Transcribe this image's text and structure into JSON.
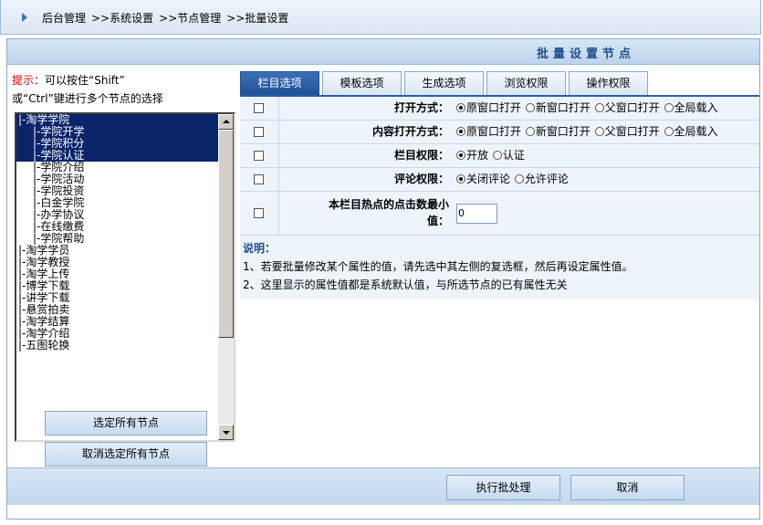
{
  "breadcrumb": [
    "后台管理",
    "系统设置",
    "节点管理",
    "批量设置"
  ],
  "breadcrumb_sep": ">>",
  "panel_title": "批量设置节点",
  "tip": {
    "label": "提示：",
    "line1": "可以按住“Shift”",
    "line2": "或“Ctrl”键进行多个节点的选择"
  },
  "nodes": [
    {
      "label": "|-淘学学院",
      "selected": true,
      "indent": false
    },
    {
      "label": "|-学院开学",
      "selected": true,
      "indent": true
    },
    {
      "label": "|-学院积分",
      "selected": true,
      "indent": true
    },
    {
      "label": "|-学院认证",
      "selected": true,
      "indent": true
    },
    {
      "label": "|-学院介绍",
      "selected": false,
      "indent": true
    },
    {
      "label": "|-学院活动",
      "selected": false,
      "indent": true
    },
    {
      "label": "|-学院投资",
      "selected": false,
      "indent": true
    },
    {
      "label": "|-白金学院",
      "selected": false,
      "indent": true
    },
    {
      "label": "|-办学协议",
      "selected": false,
      "indent": true
    },
    {
      "label": "|-在线缴费",
      "selected": false,
      "indent": true
    },
    {
      "label": "|-学院帮助",
      "selected": false,
      "indent": true
    },
    {
      "label": "|-淘学学员",
      "selected": false,
      "indent": false
    },
    {
      "label": "|-淘学教授",
      "selected": false,
      "indent": false
    },
    {
      "label": "|-淘学上传",
      "selected": false,
      "indent": false
    },
    {
      "label": "|-博学下载",
      "selected": false,
      "indent": false
    },
    {
      "label": "|-讲学下载",
      "selected": false,
      "indent": false
    },
    {
      "label": "|-悬赏拍卖",
      "selected": false,
      "indent": false
    },
    {
      "label": "|-淘学结算",
      "selected": false,
      "indent": false
    },
    {
      "label": "|-淘学介绍",
      "selected": false,
      "indent": false
    },
    {
      "label": "|-五图轮换",
      "selected": false,
      "indent": false
    }
  ],
  "buttons": {
    "select_all": "选定所有节点",
    "deselect_all": "取消选定所有节点",
    "execute": "执行批处理",
    "cancel": "取消"
  },
  "tabs": [
    {
      "label": "栏目选项",
      "active": true
    },
    {
      "label": "模板选项",
      "active": false
    },
    {
      "label": "生成选项",
      "active": false
    },
    {
      "label": "浏览权限",
      "active": false
    },
    {
      "label": "操作权限",
      "active": false
    }
  ],
  "rows": {
    "open_mode": {
      "label": "打开方式：",
      "options": [
        "原窗口打开",
        "新窗口打开",
        "父窗口打开",
        "全局载入"
      ],
      "selected": 0
    },
    "content_open_mode": {
      "label": "内容打开方式：",
      "options": [
        "原窗口打开",
        "新窗口打开",
        "父窗口打开",
        "全局载入"
      ],
      "selected": 0
    },
    "permission": {
      "label": "栏目权限：",
      "options": [
        "开放",
        "认证"
      ],
      "selected": 0
    },
    "comment": {
      "label": "评论权限：",
      "options": [
        "关闭评论",
        "允许评论"
      ],
      "selected": 0
    },
    "hot_clicks": {
      "label_line1": "本栏目热点的点击数最小",
      "label_line2": "值：",
      "value": "0"
    }
  },
  "notes": {
    "heading": "说明：",
    "line1": "1、若要批量修改某个属性的值，请先选中其左侧的复选框，然后再设定属性值。",
    "line2": "2、这里显示的属性值都是系统默认值，与所选节点的已有属性无关"
  }
}
